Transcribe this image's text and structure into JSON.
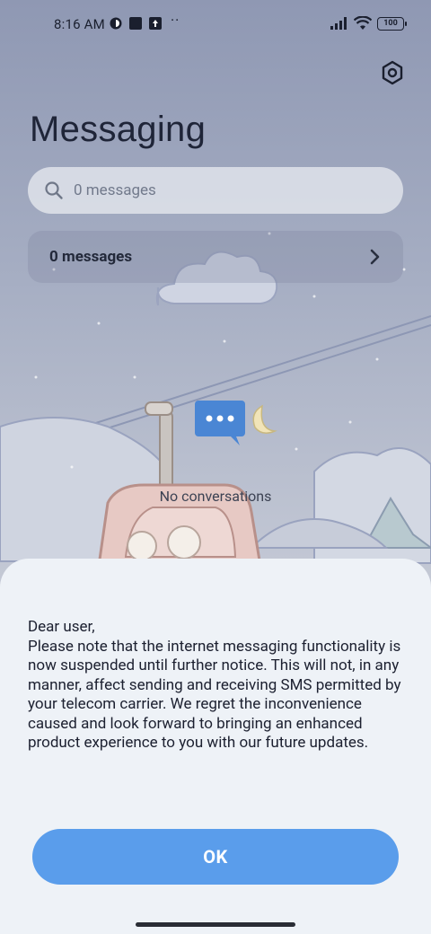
{
  "status_bar": {
    "time": "8:16 AM",
    "more": "··",
    "battery": "100"
  },
  "header": {
    "title": "Messaging",
    "settings_icon": "gear-icon"
  },
  "search": {
    "placeholder": "0 messages",
    "icon": "search-icon"
  },
  "summary_row": {
    "label": "0 messages",
    "icon": "chevron-right-icon"
  },
  "empty_state": {
    "text": "No conversations",
    "icon": "chat-bubble-icon"
  },
  "dialog": {
    "message": "Dear user,\nPlease note that the internet messaging functionality is now suspended until further notice. This will not, in any manner, affect sending and receiving SMS permitted by your telecom carrier. We regret the inconvenience caused and look forward to bringing an enhanced product experience to you with our future updates.",
    "ok_label": "OK"
  },
  "colors": {
    "accent": "#5a9deb",
    "sheet_background": "#eef2f7",
    "title_text": "#1f2538"
  }
}
